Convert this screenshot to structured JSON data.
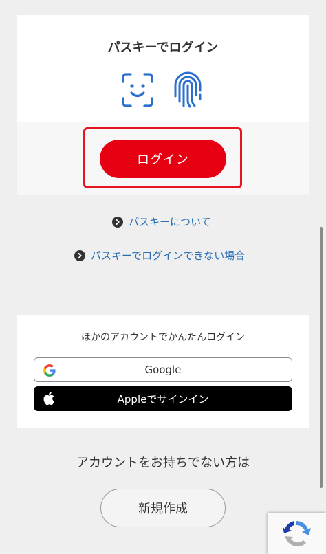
{
  "passkey": {
    "title": "パスキーでログイン",
    "login_button": "ログイン",
    "icons": [
      "face-id-icon",
      "fingerprint-icon"
    ]
  },
  "links": {
    "about_passkey": "パスキーについて",
    "cannot_login": "パスキーでログインできない場合"
  },
  "other_login": {
    "title": "ほかのアカウントでかんたんログイン",
    "google_label": "Google",
    "apple_label": "Appleでサインイン"
  },
  "signup": {
    "prompt": "アカウントをお持ちでない方は",
    "button": "新規作成"
  },
  "colors": {
    "accent_red": "#e60012",
    "link_blue": "#2a6fb5",
    "icon_blue": "#2b6fd1"
  }
}
